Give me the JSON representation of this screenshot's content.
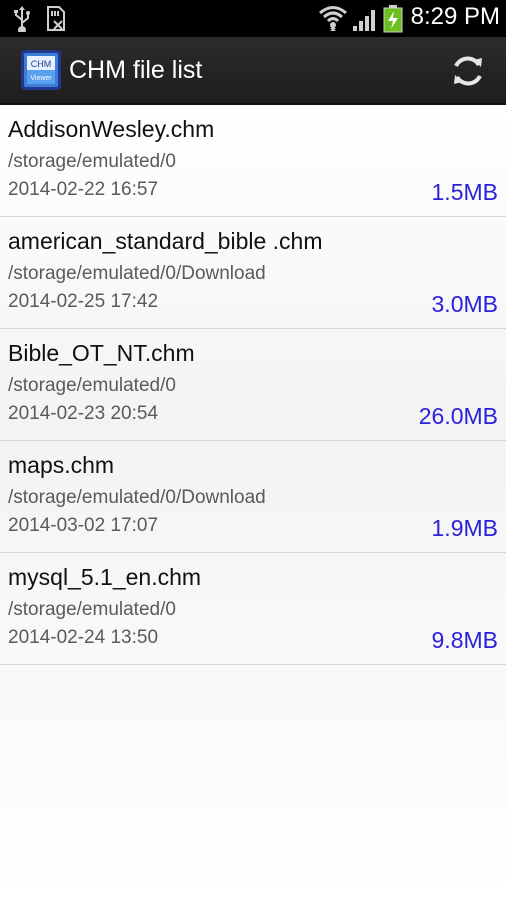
{
  "status_bar": {
    "time": "8:29 PM",
    "icons": [
      "usb-icon",
      "sd-card-icon",
      "wifi-icon",
      "signal-icon",
      "battery-charging-icon"
    ]
  },
  "action_bar": {
    "title": "CHM file list",
    "app_icon_text_top": "CHM",
    "app_icon_text_bottom": "Viewer",
    "refresh_icon": "refresh-icon"
  },
  "files": [
    {
      "name": "AddisonWesley.chm",
      "path": "/storage/emulated/0",
      "date": "2014-02-22 16:57",
      "size": "1.5MB"
    },
    {
      "name": "american_standard_bible .chm",
      "path": "/storage/emulated/0/Download",
      "date": "2014-02-25 17:42",
      "size": "3.0MB"
    },
    {
      "name": "Bible_OT_NT.chm",
      "path": "/storage/emulated/0",
      "date": "2014-02-23 20:54",
      "size": "26.0MB"
    },
    {
      "name": "maps.chm",
      "path": "/storage/emulated/0/Download",
      "date": "2014-03-02 17:07",
      "size": "1.9MB"
    },
    {
      "name": "mysql_5.1_en.chm",
      "path": "/storage/emulated/0",
      "date": "2014-02-24 13:50",
      "size": "9.8MB"
    }
  ],
  "colors": {
    "size_text": "#2a22d8",
    "action_bar": "#262626",
    "battery_charge": "#6bbf1f"
  }
}
